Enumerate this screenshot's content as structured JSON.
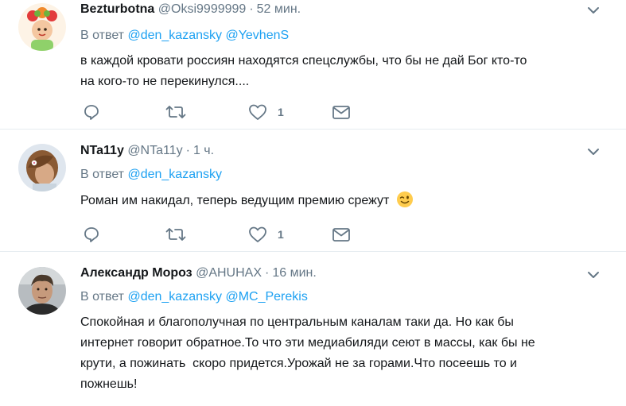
{
  "tweets": [
    {
      "name": "Bezturbotna",
      "handle": "@Oksi9999999",
      "time": "52 мин.",
      "reply_prefix": "В ответ",
      "mentions": [
        "@den_kazansky",
        "@YevhenS"
      ],
      "text_lines": [
        "в каждой кровати россиян находятся спецслужбы, что бы не дай Бог кто-то",
        "на кого-то не перекинулся...."
      ],
      "like_count": "1"
    },
    {
      "name": "NTa11y",
      "handle": "@NTa11y",
      "time": "1 ч.",
      "reply_prefix": "В ответ",
      "mentions": [
        "@den_kazansky"
      ],
      "text_lines": [
        "Роман им накидал, теперь ведущим премию срежут"
      ],
      "emoji": "winking-face",
      "like_count": "1"
    },
    {
      "name": "Александр Мороз",
      "handle": "@AHUHAX",
      "time": "16 мин.",
      "reply_prefix": "В ответ",
      "mentions": [
        "@den_kazansky",
        "@MC_Perekis"
      ],
      "text_lines": [
        "Спокойная и благополучная по центральным каналам таки да. Но как бы",
        "интернет говорит обратное.То что эти медиабиляди сеют в массы, как бы не",
        "крути, а пожинать  скоро придется.Урожай не за горами.Что посеешь то и",
        "пожнешь!"
      ]
    }
  ],
  "dot": "·",
  "colors": {
    "link": "#1da1f2",
    "muted": "#657786",
    "text": "#14171a",
    "divider": "#e6ecf0"
  }
}
